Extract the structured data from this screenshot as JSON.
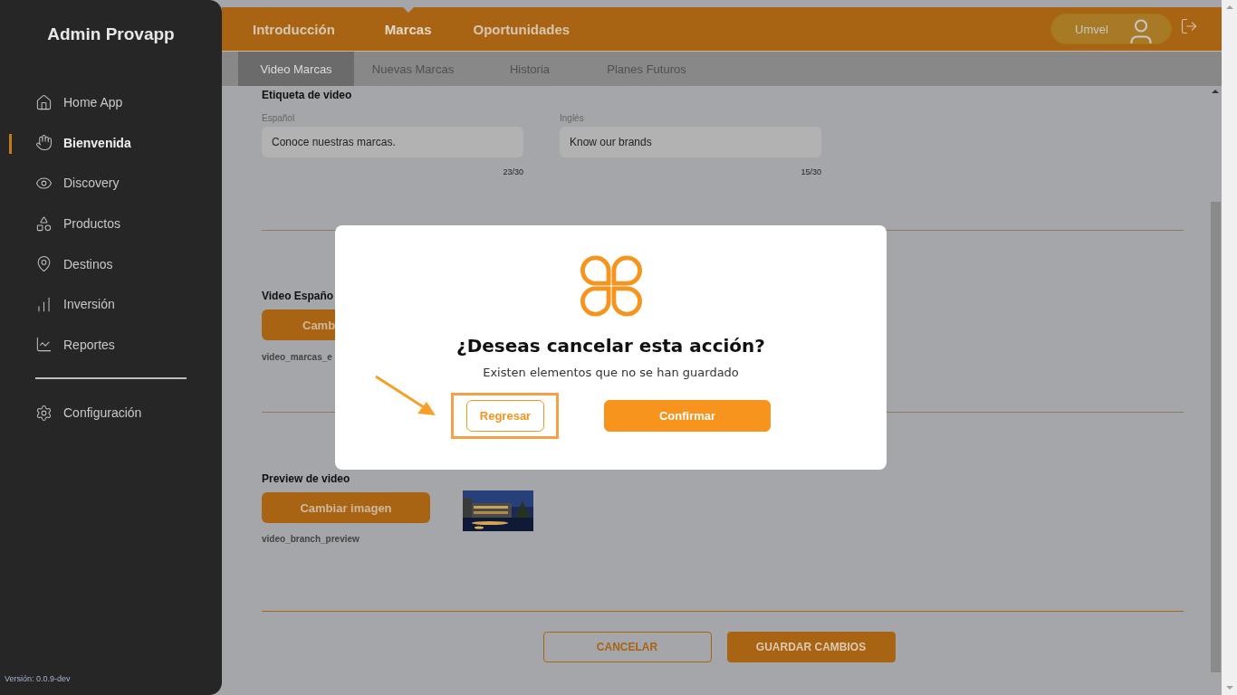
{
  "sidebar": {
    "title": "Admin Provapp",
    "items": [
      {
        "label": "Home App",
        "selected": false
      },
      {
        "label": "Bienvenida",
        "selected": true
      },
      {
        "label": "Discovery",
        "selected": false
      },
      {
        "label": "Productos",
        "selected": false
      },
      {
        "label": "Destinos",
        "selected": false
      },
      {
        "label": "Inversión",
        "selected": false
      },
      {
        "label": "Reportes",
        "selected": false
      }
    ],
    "settings": {
      "label": "Configuración",
      "selected": false
    },
    "version": "Versión: 0.0.9-dev"
  },
  "header": {
    "tabs": [
      {
        "label": "Introducción",
        "selected": false
      },
      {
        "label": "Marcas",
        "selected": true
      },
      {
        "label": "Oportunidades",
        "selected": false
      }
    ],
    "user": "Umvel"
  },
  "subtabs": [
    {
      "label": "Video Marcas",
      "selected": true
    },
    {
      "label": "Nuevas Marcas",
      "selected": false
    },
    {
      "label": "Historia",
      "selected": false
    },
    {
      "label": "Planes Futuros",
      "selected": false
    }
  ],
  "form": {
    "tag_section": {
      "title": "Etiqueta de video",
      "fields": [
        {
          "label": "Español",
          "value": "Conoce nuestras marcas.",
          "counter": "23/30"
        },
        {
          "label": "Inglés",
          "value": "Know our brands",
          "counter": "15/30"
        }
      ]
    },
    "video_section": {
      "title": "Video Españo",
      "button": "Camb",
      "file": "video_marcas_e"
    },
    "preview_section": {
      "title": "Preview de video",
      "button": "Cambiar imagen",
      "file": "video_branch_preview"
    },
    "actions": [
      {
        "label": "CANCELAR",
        "kind": "outline"
      },
      {
        "label": "GUARDAR CAMBIOS",
        "kind": "filled"
      }
    ]
  },
  "dialog": {
    "title": "¿Deseas cancelar esta acción?",
    "message": "Existen elementos que no se han guardado",
    "buttons": [
      {
        "label": "Regresar",
        "kind": "outline",
        "highlighted": true
      },
      {
        "label": "Confirmar",
        "kind": "filled",
        "highlighted": false
      }
    ]
  }
}
